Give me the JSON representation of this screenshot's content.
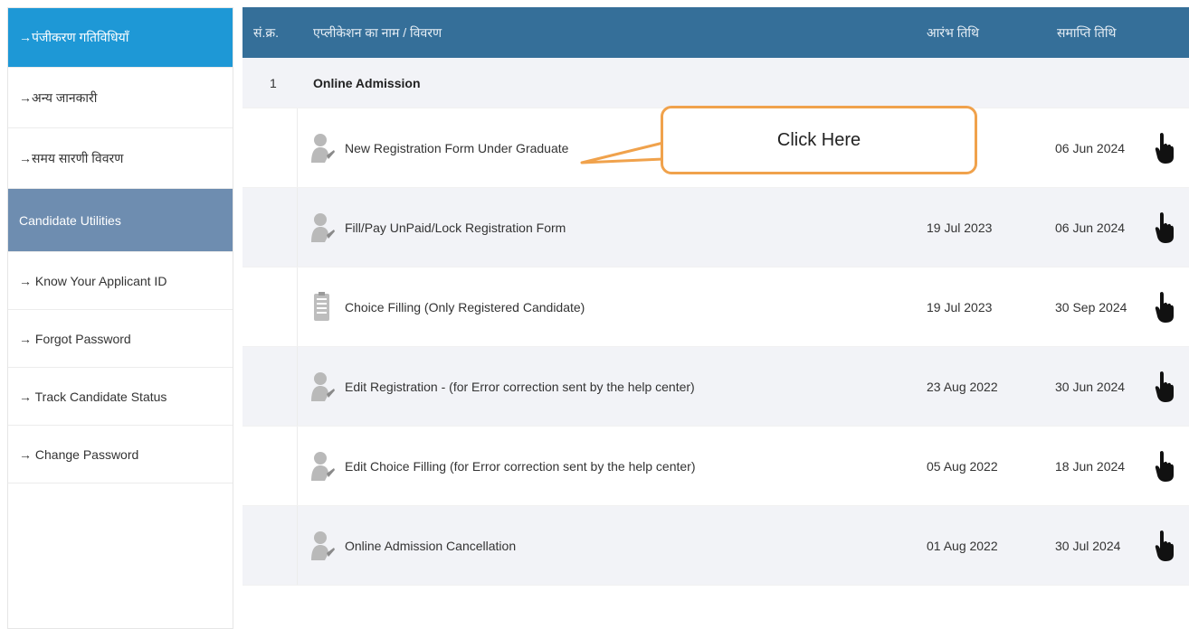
{
  "sidebar": {
    "items": [
      {
        "label": "→पंजीकरण गतिविधियाँ"
      },
      {
        "label": "→अन्य जानकारी"
      },
      {
        "label": "→समय सारणी विवरण"
      },
      {
        "label": "Candidate Utilities"
      },
      {
        "label": "→ Know Your Applicant ID"
      },
      {
        "label": "→ Forgot Password"
      },
      {
        "label": "→ Track Candidate Status"
      },
      {
        "label": "→ Change Password"
      }
    ]
  },
  "table": {
    "headers": {
      "sn": "सं.क्र.",
      "name": "एप्लीकेशन का नाम / विवरण",
      "start": "आरंभ तिथि",
      "end": "समाप्ति तिथि"
    },
    "group": {
      "sn": "1",
      "title": "Online Admission"
    },
    "rows": [
      {
        "name": "New Registration Form Under Graduate",
        "start": "",
        "end": "06 Jun 2024",
        "icon": "user-icon"
      },
      {
        "name": "Fill/Pay UnPaid/Lock Registration Form",
        "start": "19 Jul 2023",
        "end": "06 Jun 2024",
        "icon": "user-icon"
      },
      {
        "name": "Choice Filling (Only Registered Candidate)",
        "start": "19 Jul 2023",
        "end": "30 Sep 2024",
        "icon": "document-icon"
      },
      {
        "name": "Edit Registration - (for Error correction sent by the help center)",
        "start": "23 Aug 2022",
        "end": "30 Jun 2024",
        "icon": "user-icon"
      },
      {
        "name": "Edit Choice Filling (for Error correction sent by the help center)",
        "start": "05 Aug 2022",
        "end": "18 Jun 2024",
        "icon": "user-icon"
      },
      {
        "name": "Online Admission Cancellation",
        "start": "01 Aug 2022",
        "end": "30 Jul 2024",
        "icon": "user-icon"
      }
    ]
  },
  "callout": {
    "text": "Click Here"
  },
  "colors": {
    "header_bg": "#356f99",
    "active_item": "#1e98d6",
    "section_item": "#6e8db0",
    "callout_border": "#f0a24c"
  }
}
